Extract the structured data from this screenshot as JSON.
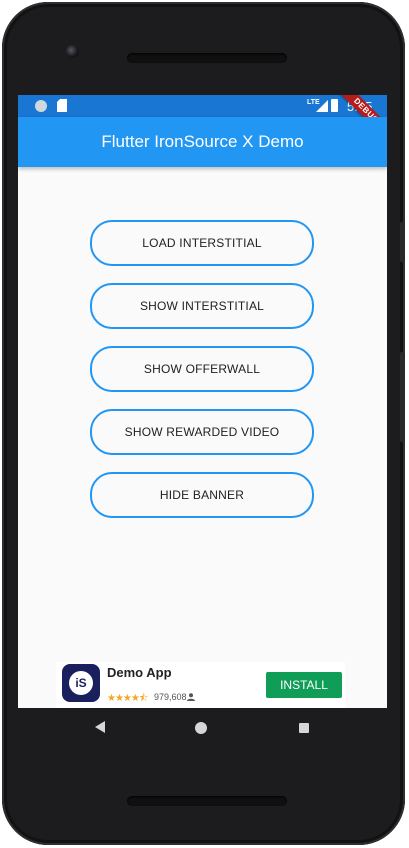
{
  "status_bar": {
    "network_label": "LTE",
    "time": "5:35",
    "debug_banner": "DEBUG"
  },
  "app_bar": {
    "title": "Flutter IronSource X Demo",
    "color": "#2196f3"
  },
  "buttons": [
    {
      "label": "LOAD INTERSTITIAL"
    },
    {
      "label": "SHOW INTERSTITIAL"
    },
    {
      "label": "SHOW OFFERWALL"
    },
    {
      "label": "SHOW REWARDED VIDEO"
    },
    {
      "label": "HIDE BANNER"
    }
  ],
  "banner_ad": {
    "app_name": "Demo App",
    "icon_text": "iS",
    "stars": "★★★★⯪",
    "rating_value": 4.5,
    "install_count": "979,608",
    "install_label": "INSTALL",
    "install_color": "#0f9d58"
  },
  "icons": {
    "status_left": [
      "notification-circle-icon",
      "sd-card-icon"
    ],
    "status_right": [
      "lte-icon",
      "signal-icon",
      "battery-icon"
    ],
    "nav": [
      "back-icon",
      "home-icon",
      "recents-icon"
    ],
    "ad_user": "user-icon"
  }
}
